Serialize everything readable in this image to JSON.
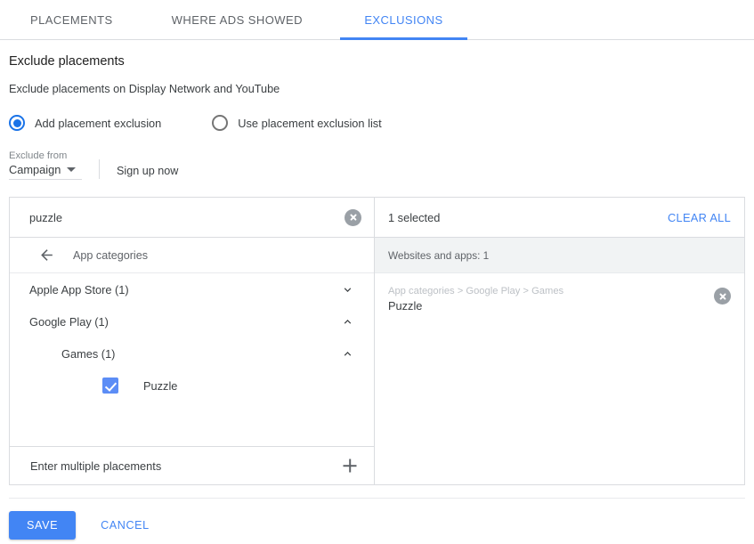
{
  "tabs": [
    {
      "label": "PLACEMENTS",
      "active": false
    },
    {
      "label": "WHERE ADS SHOWED",
      "active": false
    },
    {
      "label": "EXCLUSIONS",
      "active": true
    }
  ],
  "page": {
    "title": "Exclude placements",
    "subtitle": "Exclude placements on Display Network and YouTube"
  },
  "mode_options": [
    {
      "label": "Add placement exclusion",
      "selected": true
    },
    {
      "label": "Use placement exclusion list",
      "selected": false
    }
  ],
  "exclude_from": {
    "caption": "Exclude from",
    "value": "Campaign",
    "signup_label": "Sign up now"
  },
  "search": {
    "value": "puzzle",
    "placeholder": "Search",
    "clear_icon": "clear-circle-icon"
  },
  "browser": {
    "back_icon": "arrow-back-icon",
    "breadcrumb_label": "App categories",
    "tree": [
      {
        "label": "Apple App Store (1)",
        "level": 1,
        "type": "node",
        "expanded": false,
        "chevron": "chevron-down-icon"
      },
      {
        "label": "Google Play (1)",
        "level": 1,
        "type": "node",
        "expanded": true,
        "chevron": "chevron-up-icon"
      },
      {
        "label": "Games (1)",
        "level": 2,
        "type": "node",
        "expanded": true,
        "chevron": "chevron-up-icon"
      },
      {
        "label": "Puzzle",
        "level": 3,
        "type": "leaf",
        "checked": true
      }
    ],
    "multiple_label": "Enter multiple placements",
    "multiple_icon": "plus-icon"
  },
  "selected_panel": {
    "count_label": "1 selected",
    "clear_all_label": "CLEAR ALL",
    "group_label": "Websites and apps: 1",
    "items": [
      {
        "breadcrumb": "App categories > Google Play > Games",
        "name": "Puzzle",
        "remove_icon": "remove-circle-icon"
      }
    ]
  },
  "footer": {
    "save_label": "SAVE",
    "cancel_label": "CANCEL"
  },
  "colors": {
    "accent": "#4285f4",
    "radio_selected": "#1a73e8",
    "checkbox": "#5c8df6",
    "icon_grey": "#9aa0a6",
    "border": "#dadce0"
  }
}
